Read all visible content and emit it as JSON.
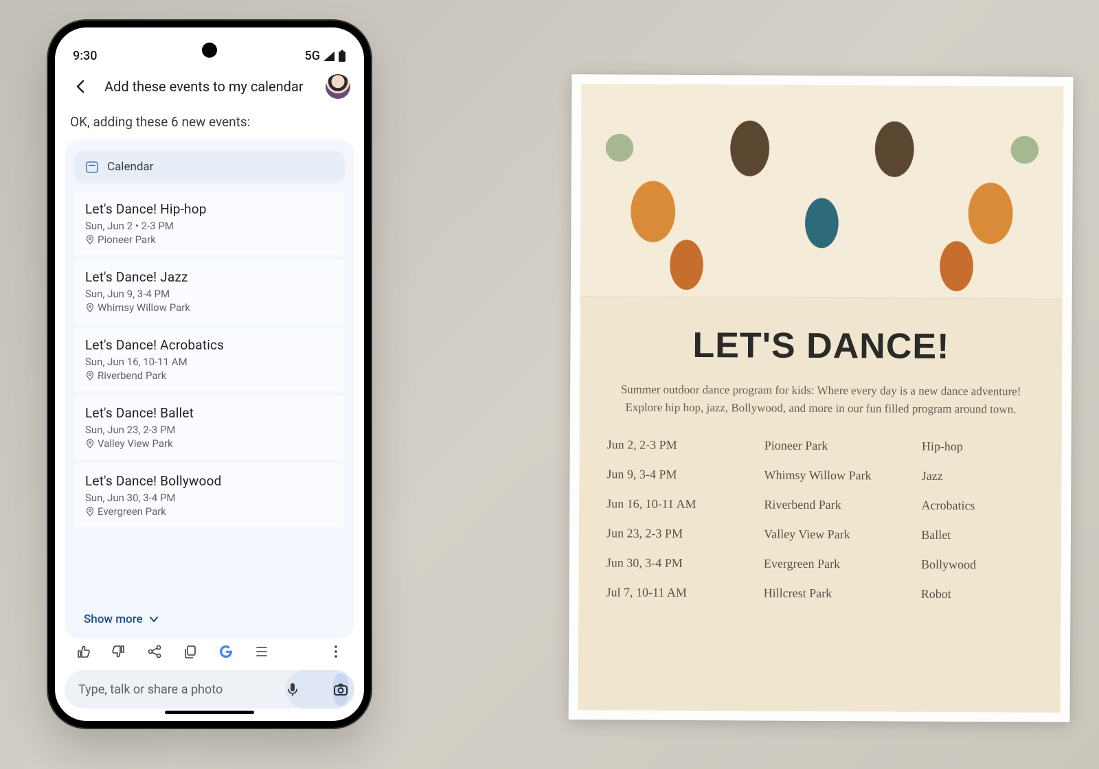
{
  "status": {
    "time": "9:30",
    "network": "5G"
  },
  "header": {
    "query": "Add these events to my calendar",
    "confirm": "OK, adding these 6 new events:"
  },
  "card": {
    "app_label": "Calendar",
    "show_more": "Show more",
    "events": [
      {
        "title": "Let's Dance! Hip-hop",
        "sub": "Sun, Jun 2 • 2-3 PM",
        "loc": "Pioneer Park"
      },
      {
        "title": "Let's Dance! Jazz",
        "sub": "Sun, Jun 9, 3-4 PM",
        "loc": "Whimsy Willow Park"
      },
      {
        "title": "Let's Dance! Acrobatics",
        "sub": "Sun, Jun 16, 10-11 AM",
        "loc": "Riverbend Park"
      },
      {
        "title": "Let's Dance! Ballet",
        "sub": "Sun, Jun 23, 2-3 PM",
        "loc": "Valley View Park"
      },
      {
        "title": "Let's Dance! Bollywood",
        "sub": "Sun, Jun 30, 3-4 PM",
        "loc": "Evergreen Park"
      }
    ]
  },
  "input": {
    "placeholder": "Type, talk or share a photo"
  },
  "poster": {
    "title": "LET'S DANCE!",
    "desc": "Summer outdoor dance program for kids: Where every day is a new dance adventure! Explore hip hop, jazz, Bollywood, and more in our fun filled program around town.",
    "rows": [
      {
        "date": "Jun 2, 2-3 PM",
        "place": "Pioneer Park",
        "style": "Hip-hop"
      },
      {
        "date": "Jun 9, 3-4 PM",
        "place": "Whimsy Willow Park",
        "style": "Jazz"
      },
      {
        "date": "Jun 16, 10-11 AM",
        "place": "Riverbend Park",
        "style": "Acrobatics"
      },
      {
        "date": "Jun 23, 2-3 PM",
        "place": "Valley View Park",
        "style": "Ballet"
      },
      {
        "date": "Jun 30, 3-4 PM",
        "place": "Evergreen Park",
        "style": "Bollywood"
      },
      {
        "date": "Jul 7, 10-11 AM",
        "place": "Hillcrest Park",
        "style": "Robot"
      }
    ]
  }
}
